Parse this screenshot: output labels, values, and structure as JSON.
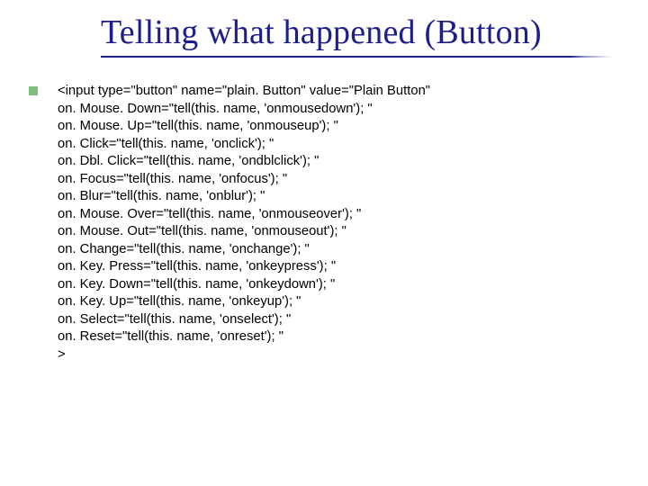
{
  "title": "Telling what happened (Button)",
  "underline_width": 489,
  "code_lines": [
    "<input type=\"button\" name=\"plain. Button\" value=\"Plain Button\"",
    "on. Mouse. Down=\"tell(this. name, 'onmousedown'); \"",
    "on. Mouse. Up=\"tell(this. name, 'onmouseup'); \"",
    "on. Click=\"tell(this. name, 'onclick'); \"",
    "on. Dbl. Click=\"tell(this. name, 'ondblclick'); \"",
    "on. Focus=\"tell(this. name, 'onfocus'); \"",
    "on. Blur=\"tell(this. name, 'onblur'); \"",
    "on. Mouse. Over=\"tell(this. name, 'onmouseover'); \"",
    "on. Mouse. Out=\"tell(this. name, 'onmouseout'); \"",
    "on. Change=\"tell(this. name, 'onchange'); \"",
    "on. Key. Press=\"tell(this. name, 'onkeypress'); \"",
    "on. Key. Down=\"tell(this. name, 'onkeydown'); \"",
    "on. Key. Up=\"tell(this. name, 'onkeyup'); \"",
    "on. Select=\"tell(this. name, 'onselect'); \"",
    "on. Reset=\"tell(this. name, 'onreset'); \"",
    ">"
  ]
}
